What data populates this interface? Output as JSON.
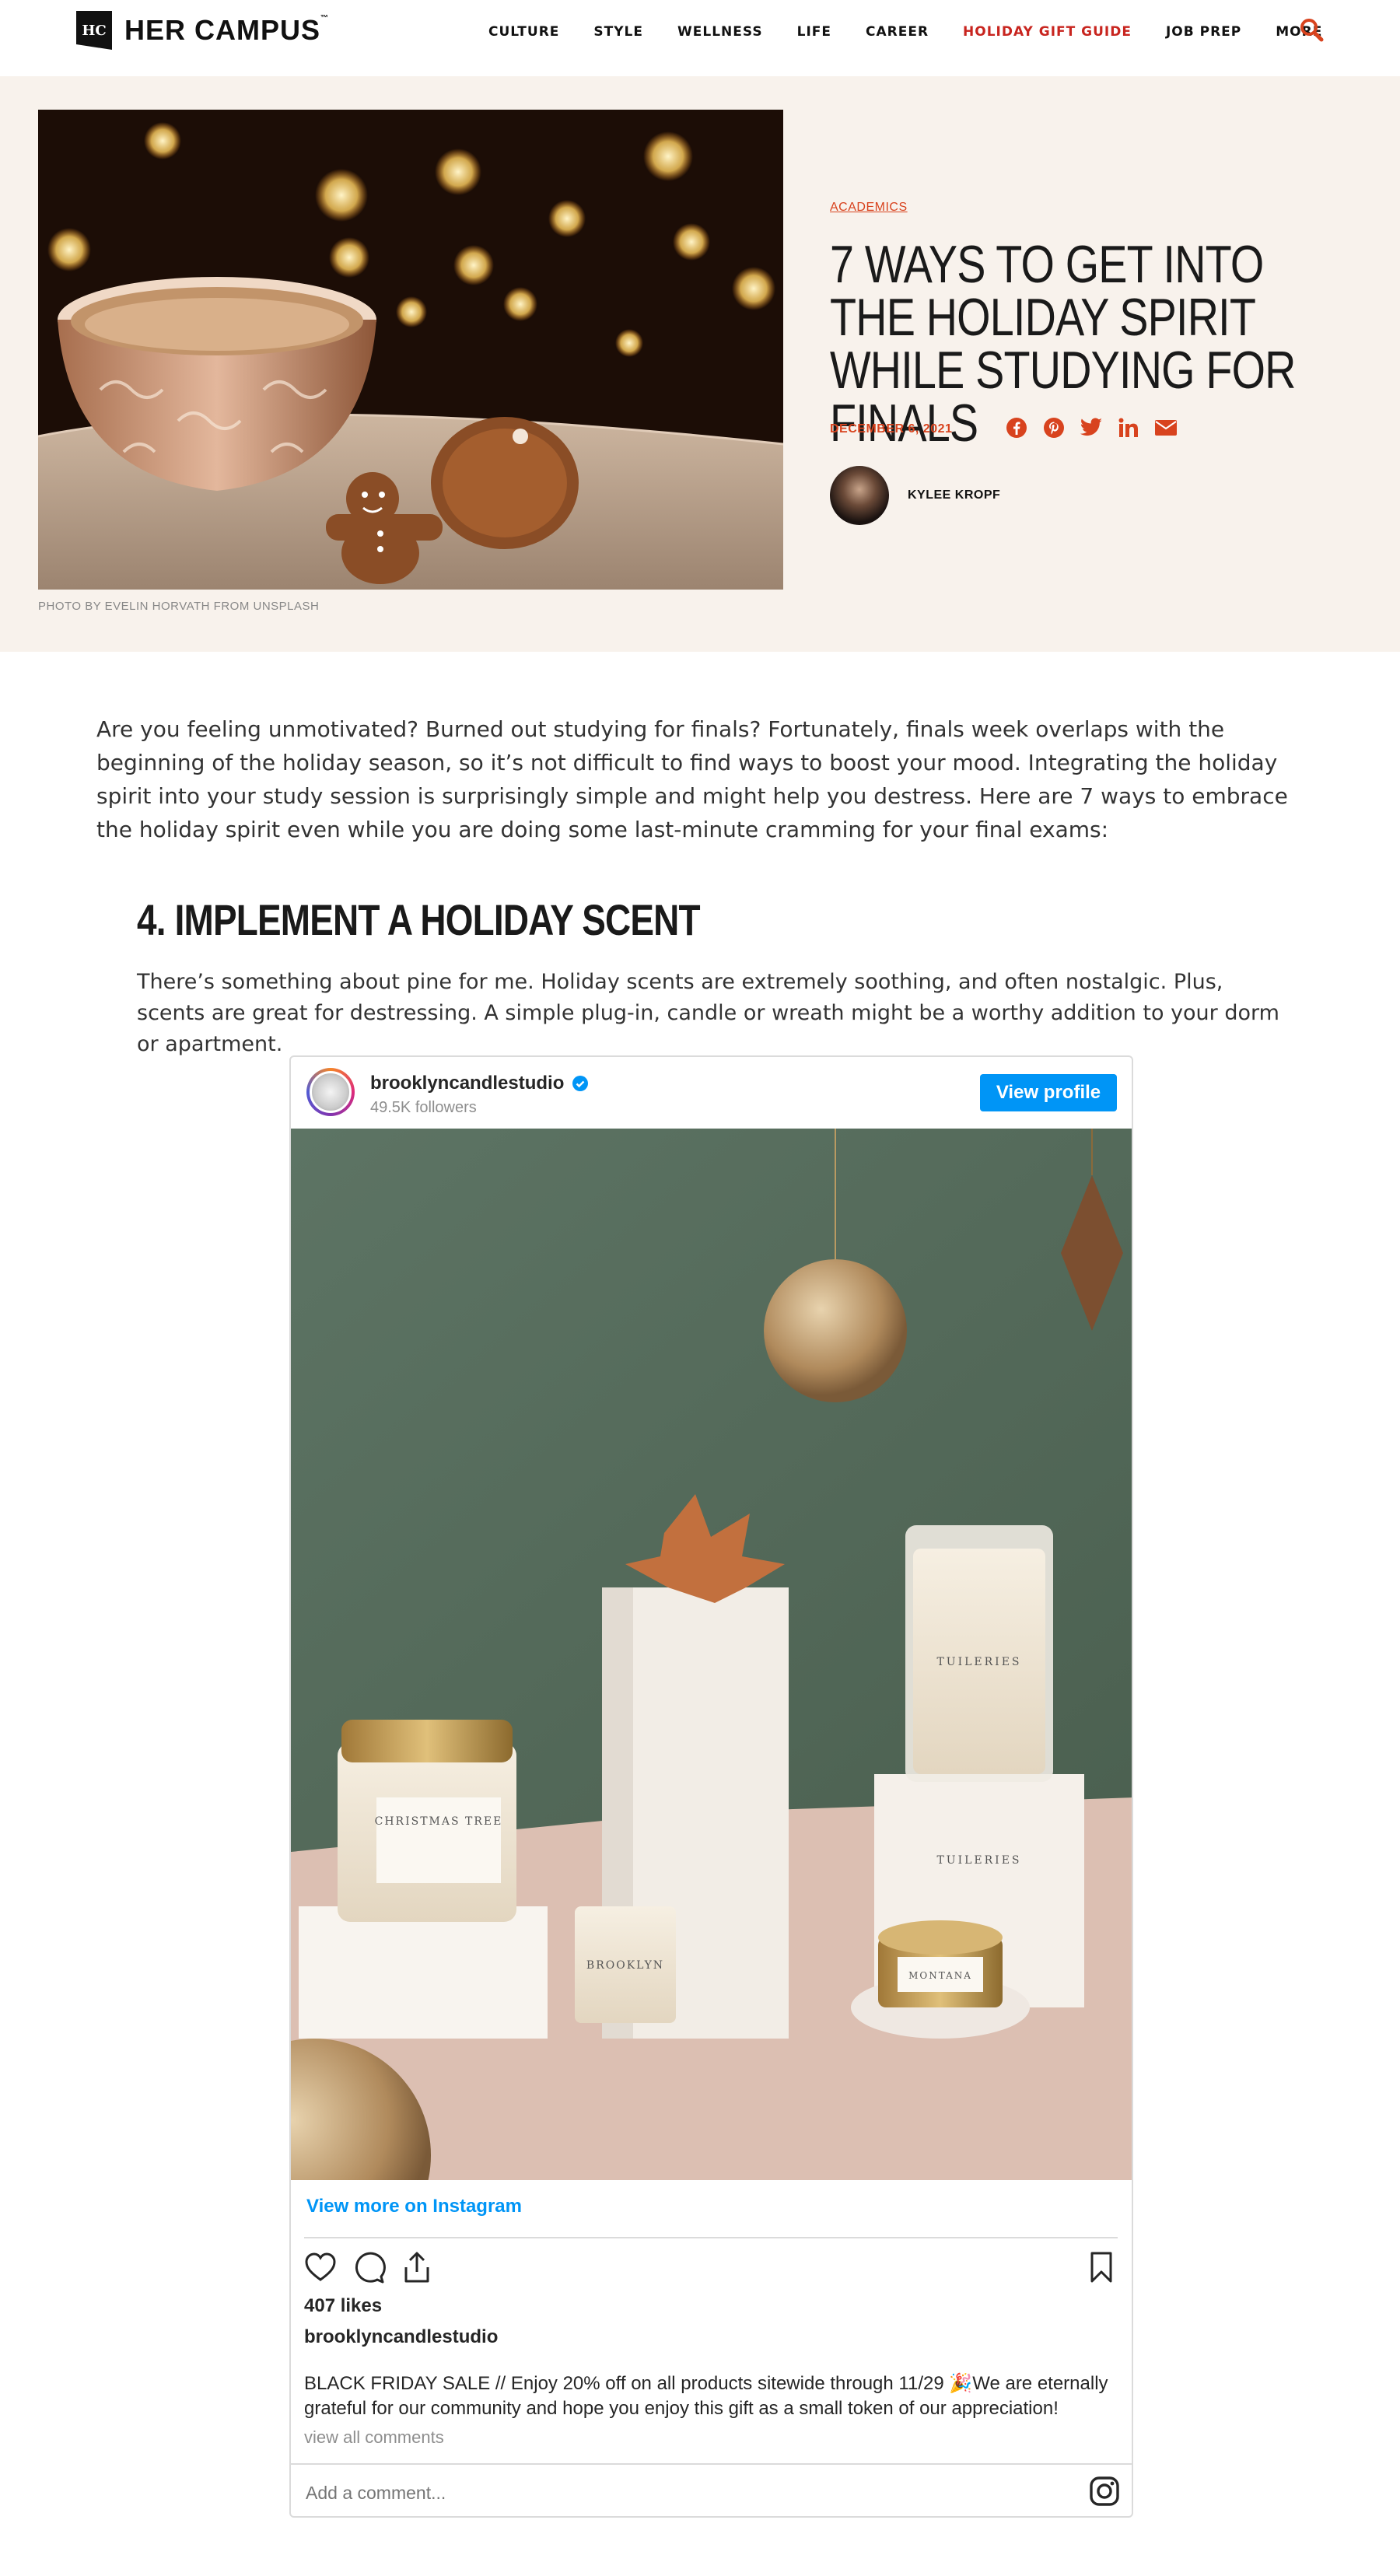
{
  "site": {
    "logo_mark": "HC",
    "logo_text": "HER CAMPUS",
    "trademark": "™"
  },
  "nav": {
    "items": [
      "CULTURE",
      "STYLE",
      "WELLNESS",
      "LIFE",
      "CAREER",
      "HOLIDAY GIFT GUIDE",
      "JOB PREP",
      "MORE"
    ],
    "highlight_color": "#c8251f",
    "search_icon": "search-icon"
  },
  "hero": {
    "photo_credit": "PHOTO BY EVELIN HORVATH FROM UNSPLASH",
    "category": "ACADEMICS",
    "title": "7 Ways to Get into the Holiday Spirit While Studying for Finals",
    "date": "DECEMBER 6, 2021",
    "share_icons": [
      "facebook-icon",
      "pinterest-icon",
      "twitter-icon",
      "linkedin-icon",
      "email-icon"
    ],
    "author": "KYLEE KROPF",
    "accent_color": "#d8431e",
    "background": "#f8f2ec"
  },
  "article": {
    "intro": "Are you feeling unmotivated? Burned out studying for finals? Fortunately, finals week overlaps with the beginning of the holiday season, so it’s not difficult to find ways to boost your mood. Integrating the holiday spirit into your study session is surprisingly simple and might help you destress. Here are 7 ways to embrace the holiday spirit even while you are doing some last-minute cramming for your final exams:",
    "section_title": "4. IMPLEMENT A HOLIDAY SCENT",
    "section_text": "There’s something about pine for me. Holiday scents are extremely soothing, and often nostalgic. Plus, scents are great for destressing. A simple plug-in, candle or wreath might be a worthy addition to your dorm or apartment."
  },
  "instagram": {
    "username": "brooklyncandlestudio",
    "followers": "49.5K followers",
    "view_profile": "View profile",
    "view_more": "View more on Instagram",
    "likes": "407 likes",
    "caption": "BLACK FRIDAY SALE // Enjoy 20% off on all products sitewide through 11/29 🎉We are eternally grateful for our community and hope you enjoy this gift as a small token of our appreciation!",
    "view_comments": "view all comments",
    "add_comment_placeholder": "Add a comment...",
    "button_color": "#0095f6",
    "candle_labels": [
      "CHRISTMAS TREE",
      "BROOKLYN",
      "TUILERIES",
      "TUILERIES",
      "MONTANA"
    ]
  }
}
